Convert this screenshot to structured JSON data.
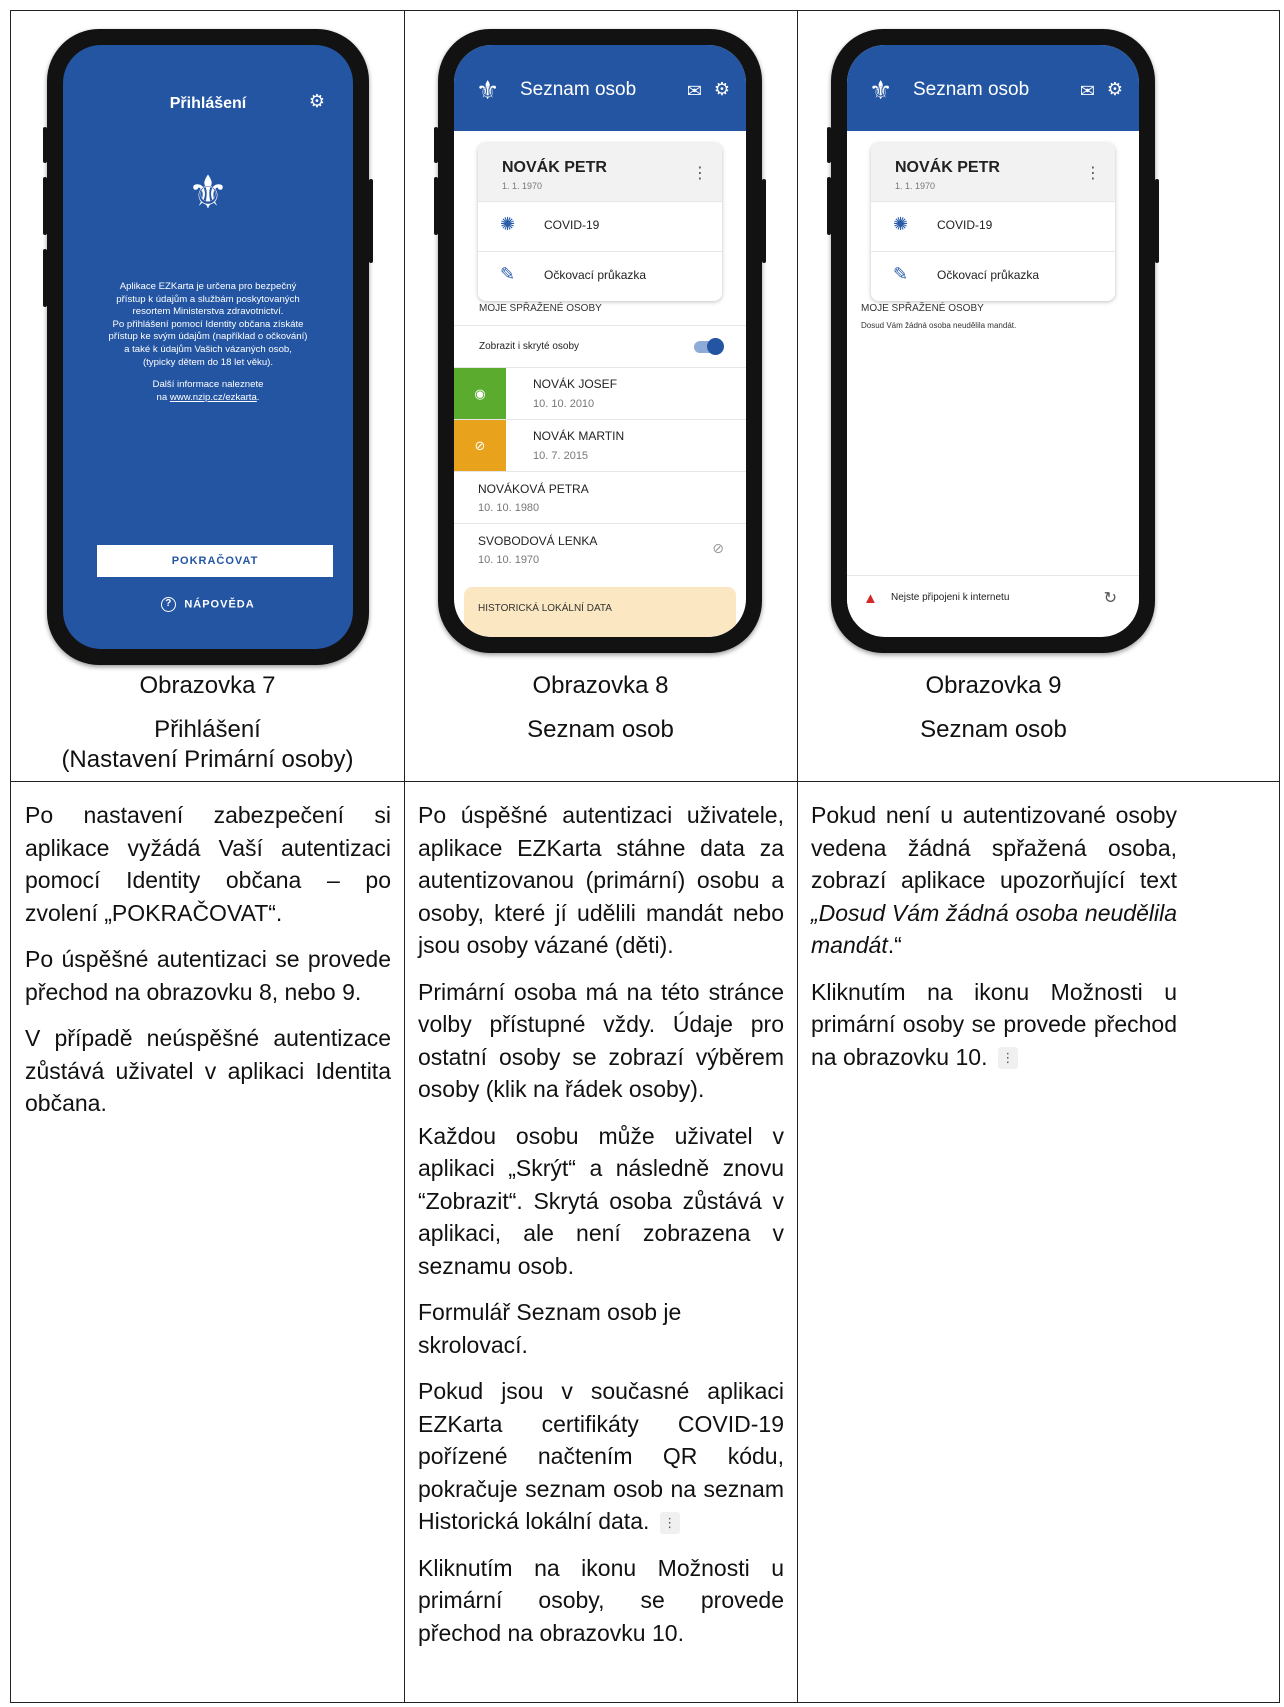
{
  "columns": [
    {
      "caption_line1": "Obrazovka 7",
      "caption_line2": "Přihlášení",
      "caption_line3": "(Nastavení Primární osoby)",
      "paragraphs": [
        "Po nastavení zabezpečení si aplikace vyžádá Vaší autentizaci pomocí Identity občana – po zvolení „POKRAČOVAT“.",
        "Po úspěšné autentizaci se provede přechod na obrazovku 8, nebo 9.",
        "V případě neúspěšné autentizace zůstává uživatel v aplikaci Identita občana."
      ]
    },
    {
      "caption_line1": "Obrazovka 8",
      "caption_line2": "Seznam osob",
      "paragraphs": [
        "Po úspěšné autentizaci uživatele, aplikace EZKarta stáhne data za autentizovanou (primární) osobu a osoby, které jí udělili mandát nebo jsou osoby vázané (děti).",
        "Primární osoba má na této stránce volby přístupné vždy. Údaje pro ostatní osoby se zobrazí výběrem osoby (klik na řádek osoby).",
        "Každou osobu může uživatel v aplikaci „Skrýt“ a následně znovu “Zobrazit“. Skrytá osoba zůstává v aplikaci, ale není zobrazena v seznamu osob.",
        "Formulář Seznam osob je skrolovací.",
        "Pokud jsou v současné aplikaci EZKarta certifikáty COVID-19 pořízené načtením QR kódu, pokračuje seznam osob na seznam Historická lokální data.",
        "Kliknutím na ikonu Možnosti u primární osoby, se provede přechod na obrazovku 10."
      ]
    },
    {
      "caption_line1": "Obrazovka 9",
      "caption_line2": "Seznam osob",
      "p1_normal": "Pokud není u autentizované osoby vedena žádná spřažená osoba, zobrazí aplikace upozorňující text ",
      "p1_italic": "„Dosud Vám žádná osoba neudělila mandát",
      "p1_end": ".“",
      "p2": "Kliknutím na ikonu Možnosti u primární osoby se provede přechod na obrazovku 10."
    }
  ],
  "screen7": {
    "title": "Přihlášení",
    "info_lines": [
      "Aplikace EZKarta je určena pro bezpečný",
      "přístup k údajům a službám poskytovaných",
      "resortem Ministerstva zdravotnictví.",
      "Po přihlášení pomocí Identity občana získáte",
      "přístup ke svým údajům (například o očkování)",
      "a také k údajům Vašich vázaných osob,",
      "(typicky dětem do 18 let věku)."
    ],
    "more_info_1": "Další informace naleznete",
    "more_info_2": "na",
    "link": "www.nzip.cz/ezkarta",
    "continue_label": "POKRAČOVAT",
    "help_label": "NÁPOVĚDA"
  },
  "screen8": {
    "title": "Seznam osob",
    "primary_name": "NOVÁK PETR",
    "primary_dob": "1. 1. 1970",
    "covid_label": "COVID-19",
    "vacc_label": "Očkovací průkazka",
    "linked_header": "MOJE SPŘAŽENÉ OSOBY",
    "toggle_label": "Zobrazit i skryté osoby",
    "persons": [
      {
        "name": "NOVÁK JOSEF",
        "dob": "10. 10. 2010"
      },
      {
        "name": "NOVÁK MARTIN",
        "dob": "10. 7. 2015"
      },
      {
        "name": "NOVÁKOVÁ PETRA",
        "dob": "10. 10. 1980"
      },
      {
        "name": "SVOBODOVÁ LENKA",
        "dob": "10. 10. 1970"
      }
    ],
    "history_label": "HISTORICKÁ LOKÁLNÍ DATA"
  },
  "screen9": {
    "title": "Seznam osob",
    "primary_name": "NOVÁK PETR",
    "primary_dob": "1. 1. 1970",
    "covid_label": "COVID-19",
    "vacc_label": "Očkovací průkazka",
    "linked_header": "MOJE SPŘAŽENÉ OSOBY",
    "empty_text": "Dosud Vám žádná osoba neudělila mandát.",
    "offline_text": "Nejste připojeni k internetu"
  },
  "colors": {
    "app_blue": "#2355a3",
    "green": "#5aab2e",
    "orange": "#e9a21b",
    "history_bg": "#fbe8c3"
  }
}
